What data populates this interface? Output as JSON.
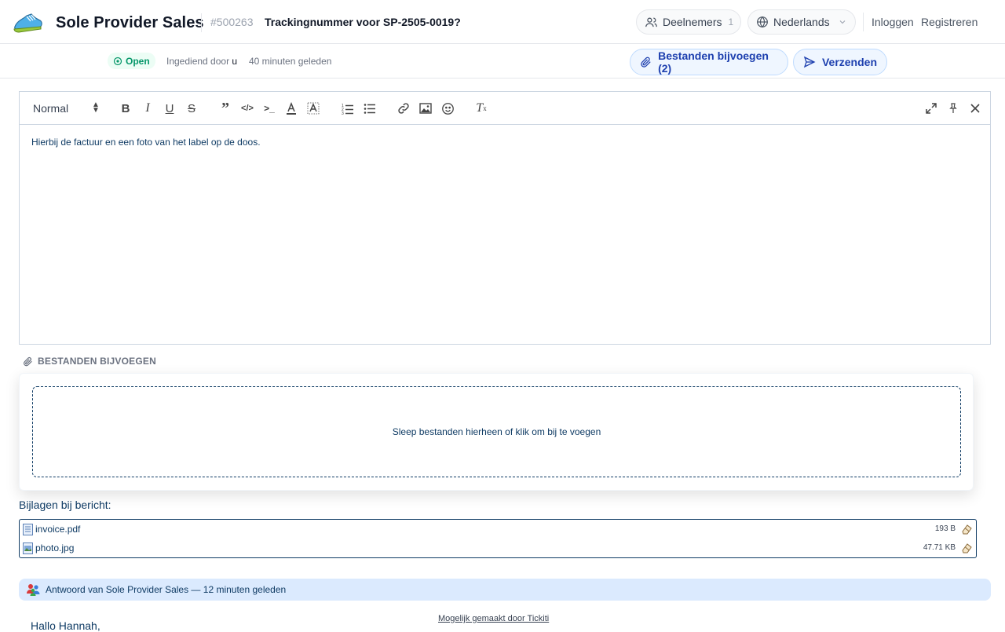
{
  "header": {
    "brand": "Sole Provider Sales",
    "ticket_id": "#500263",
    "ticket_title": "Trackingnummer voor SP-2505-0019?",
    "participants_label": "Deelnemers",
    "participants_count": "1",
    "language_label": "Nederlands",
    "login_label": "Inloggen",
    "register_label": "Registreren"
  },
  "subheader": {
    "status": "Open",
    "submitted_prefix": "Ingediend door",
    "submitted_by": "u",
    "time_ago": "40 minuten geleden",
    "attach_button": "Bestanden bijvoegen (2)",
    "send_button": "Verzenden"
  },
  "editor": {
    "format_select": "Normal",
    "content": "Hierbij de factuur en een foto van het label op de doos."
  },
  "attach": {
    "heading": "BESTANDEN BIJVOEGEN",
    "dropzone_text": "Sleep bestanden hierheen of klik om bij te voegen",
    "list_label": "Bijlagen bij bericht:",
    "files": [
      {
        "name": "invoice.pdf",
        "size": "193 B"
      },
      {
        "name": "photo.jpg",
        "size": "47.71 KB"
      }
    ]
  },
  "reply": {
    "text": "Antwoord van Sole Provider Sales — 12 minuten geleden"
  },
  "footer": {
    "powered_by": "Mogelijk gemaakt door Tickiti",
    "greeting": "Hallo Hannah,"
  },
  "colors": {
    "accent": "#1e40af",
    "status_green": "#059669",
    "text_navy": "#0f3b64",
    "reply_bg": "#dbeafe"
  }
}
